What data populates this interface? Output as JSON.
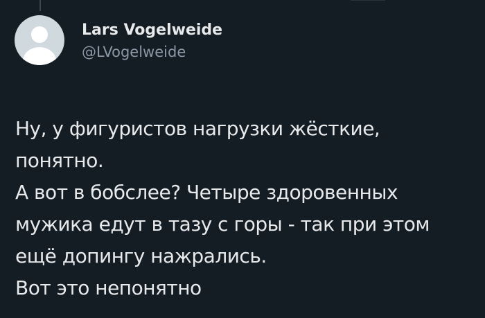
{
  "author": {
    "display_name": "Lars Vogelweide",
    "handle": "@LVogelweide",
    "avatar_icon": "default-profile-icon"
  },
  "tweet": {
    "lines": [
      "Ну, у фигуристов нагрузки жёсткие,",
      "понятно.",
      "А вот в бобслее? Четыре здоровенных",
      "мужика едут в тазу с горы - так при этом",
      "ещё допингу нажрались.",
      "Вот это непонятно"
    ]
  },
  "colors": {
    "background": "#141c24",
    "text_primary": "#e7e9ea",
    "text_secondary": "#8b98a5",
    "avatar_bg": "#cfd9de",
    "avatar_figure": "#ffffff"
  }
}
